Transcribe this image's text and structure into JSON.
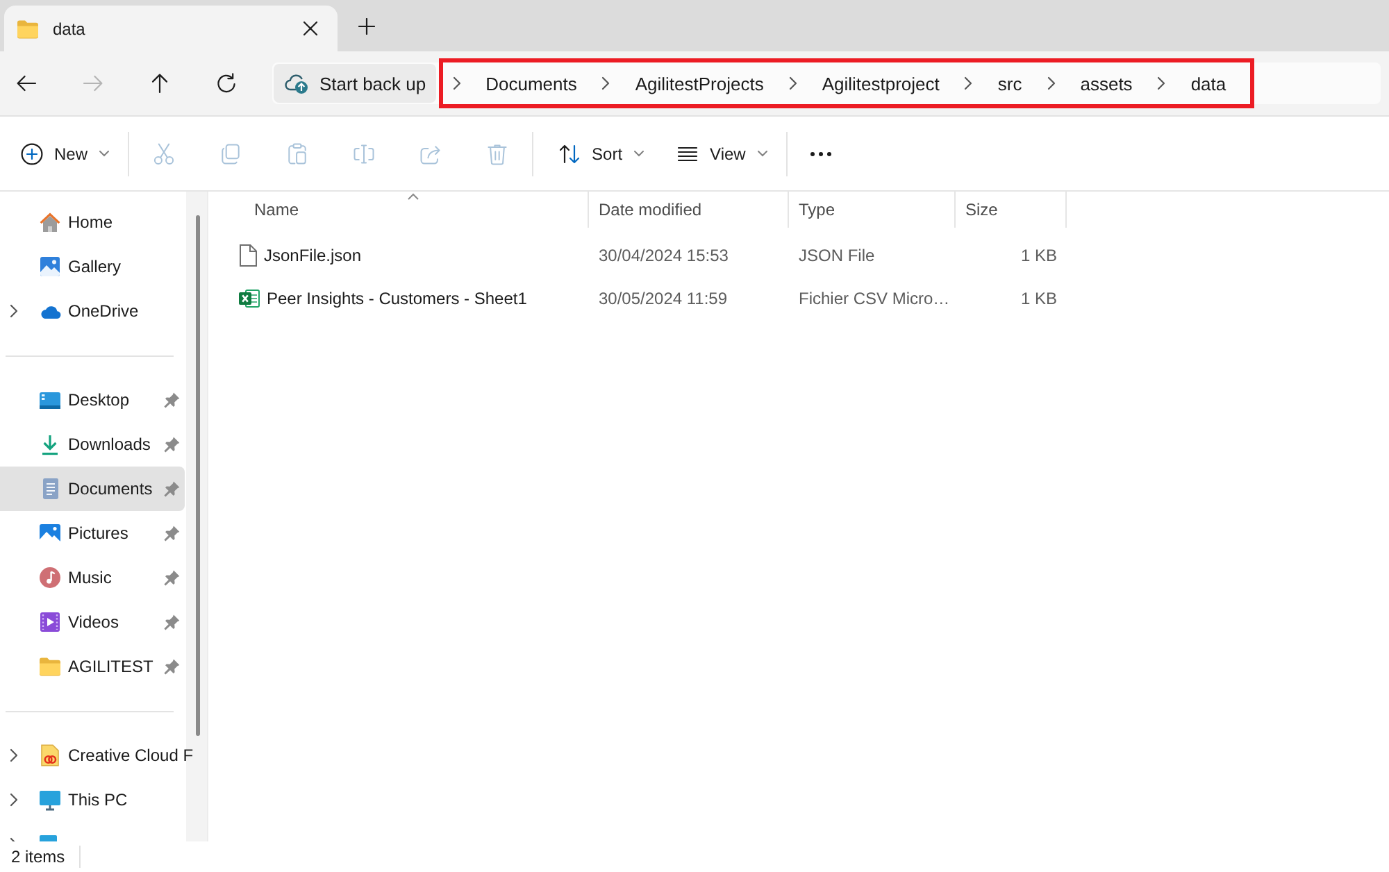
{
  "tabs": [
    {
      "title": "data",
      "selected": true
    }
  ],
  "navigation": [
    {
      "kind": "back",
      "disabled": false
    },
    {
      "kind": "forward",
      "disabled": true
    },
    {
      "kind": "up",
      "disabled": false
    },
    {
      "kind": "refresh",
      "disabled": false
    }
  ],
  "address_bar": {
    "backup_button": "Start back up",
    "breadcrumbs": [
      "Documents",
      "AgilitestProjects",
      "Agilitestproject",
      "src",
      "assets",
      "data"
    ]
  },
  "toolbar": {
    "groups": [
      [
        {
          "kind": "new",
          "label": "New",
          "disabled": false,
          "dropdown": true
        }
      ],
      [
        {
          "kind": "cut",
          "disabled": true,
          "dropdown": false
        },
        {
          "kind": "copy",
          "disabled": true,
          "dropdown": false
        },
        {
          "kind": "paste",
          "disabled": true,
          "dropdown": false
        },
        {
          "kind": "rename",
          "disabled": true,
          "dropdown": false
        },
        {
          "kind": "share",
          "disabled": true,
          "dropdown": false
        },
        {
          "kind": "delete",
          "disabled": true,
          "dropdown": false
        }
      ],
      [
        {
          "kind": "sort",
          "label": "Sort",
          "disabled": false,
          "dropdown": true
        },
        {
          "kind": "view",
          "label": "View",
          "disabled": false,
          "dropdown": true
        }
      ],
      [
        {
          "kind": "more",
          "disabled": false,
          "dropdown": false
        }
      ]
    ]
  },
  "sidebar": {
    "sections": [
      {
        "items": [
          {
            "kind": "home",
            "label": "Home",
            "expandable": false,
            "pinned": false,
            "selected": false
          },
          {
            "kind": "gallery",
            "label": "Gallery",
            "expandable": false,
            "pinned": false,
            "selected": false
          },
          {
            "kind": "onedrive",
            "label": "OneDrive",
            "expandable": true,
            "pinned": false,
            "selected": false
          }
        ]
      },
      {
        "items": [
          {
            "kind": "desktop",
            "label": "Desktop",
            "expandable": false,
            "pinned": true,
            "selected": false
          },
          {
            "kind": "downloads",
            "label": "Downloads",
            "expandable": false,
            "pinned": true,
            "selected": false
          },
          {
            "kind": "documents",
            "label": "Documents",
            "expandable": false,
            "pinned": true,
            "selected": true
          },
          {
            "kind": "pictures",
            "label": "Pictures",
            "expandable": false,
            "pinned": true,
            "selected": false
          },
          {
            "kind": "music",
            "label": "Music",
            "expandable": false,
            "pinned": true,
            "selected": false
          },
          {
            "kind": "videos",
            "label": "Videos",
            "expandable": false,
            "pinned": true,
            "selected": false
          },
          {
            "kind": "folder",
            "label": "AGILITEST",
            "expandable": false,
            "pinned": true,
            "selected": false
          }
        ]
      },
      {
        "items": [
          {
            "kind": "creative-cloud",
            "label": "Creative Cloud F",
            "expandable": true,
            "pinned": false,
            "selected": false
          },
          {
            "kind": "this-pc",
            "label": "This PC",
            "expandable": true,
            "pinned": false,
            "selected": false
          },
          {
            "kind": "network",
            "expandable": true,
            "pinned": false,
            "selected": false
          }
        ]
      }
    ]
  },
  "file_list": {
    "columns": [
      {
        "label": "Name",
        "sorted": true
      },
      {
        "label": "Date modified",
        "sorted": false
      },
      {
        "label": "Type",
        "sorted": false
      },
      {
        "label": "Size",
        "sorted": false
      }
    ],
    "rows": [
      {
        "kind": "json",
        "name": "JsonFile.json",
        "date_modified": "30/04/2024 15:53",
        "type": "JSON File",
        "size": "1 KB",
        "selected": false
      },
      {
        "kind": "spreadsheet",
        "name": "Peer Insights - Customers - Sheet1",
        "date_modified": "30/05/2024 11:59",
        "type": "Fichier CSV Micro…",
        "size": "1 KB",
        "selected": false
      }
    ]
  },
  "status_bar": {
    "item_count": "2 items"
  }
}
